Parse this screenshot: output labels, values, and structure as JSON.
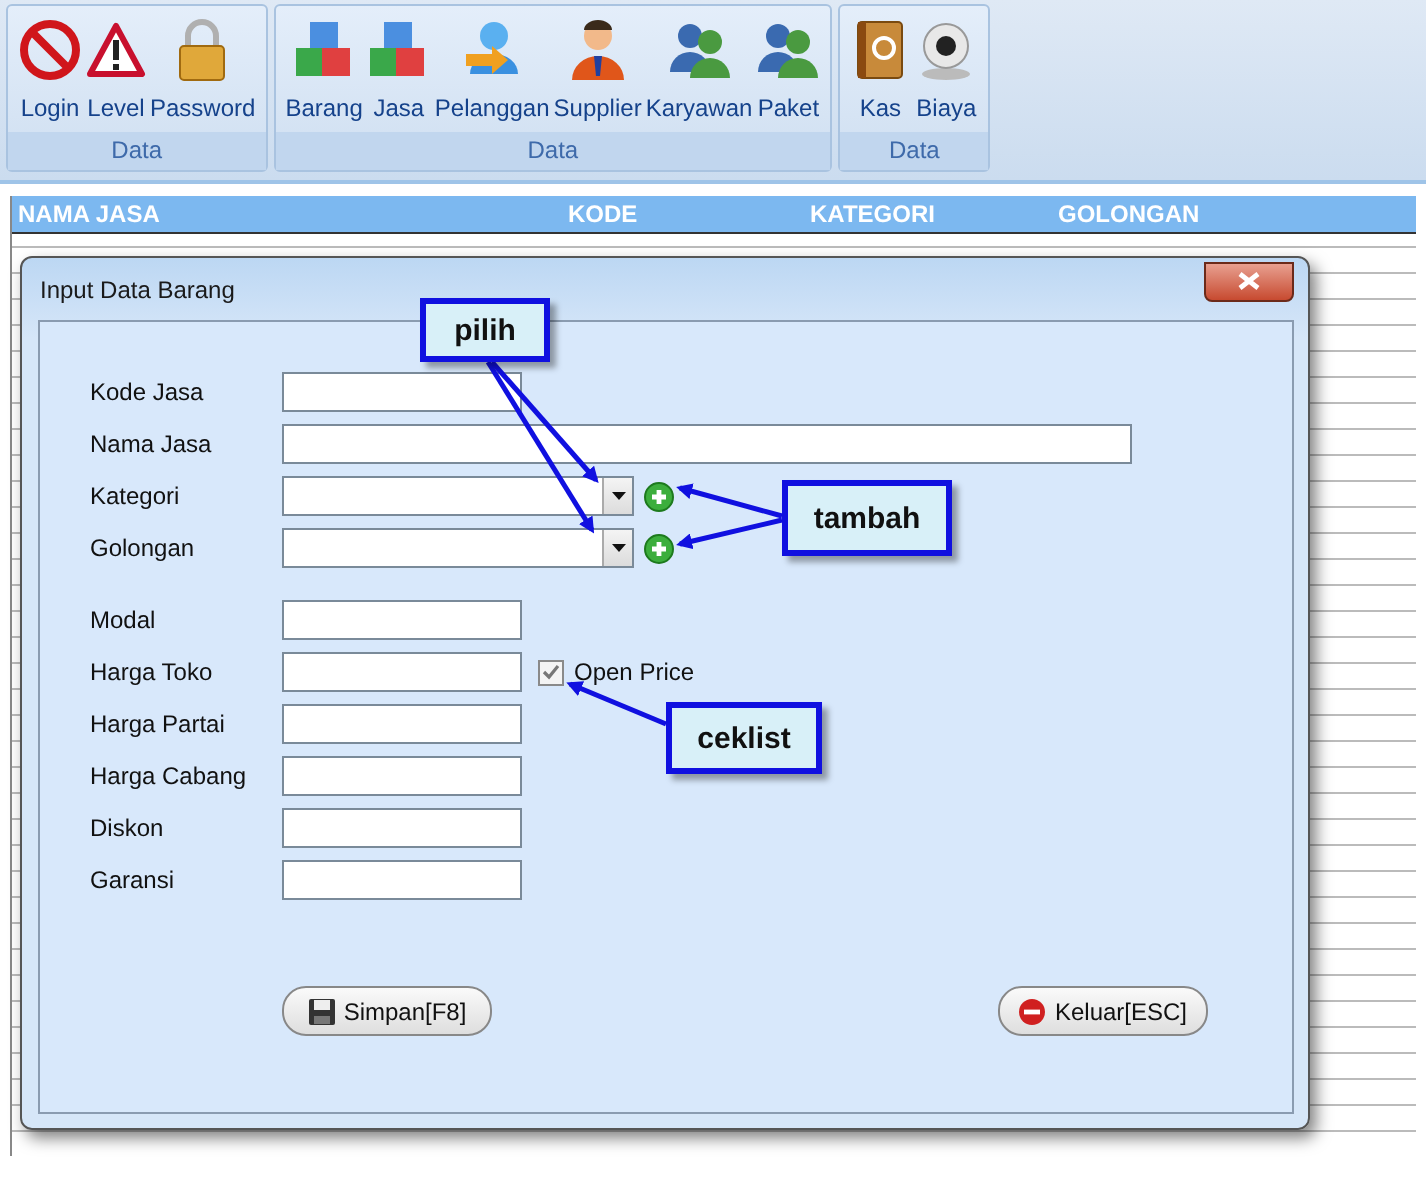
{
  "ribbon": {
    "groups": [
      {
        "caption": "Data",
        "items": [
          {
            "label": "Login",
            "kind": "forbid"
          },
          {
            "label": "Level",
            "kind": "warning"
          },
          {
            "label": "Password",
            "kind": "lock"
          }
        ]
      },
      {
        "caption": "Data",
        "items": [
          {
            "label": "Barang",
            "kind": "cubes"
          },
          {
            "label": "Jasa",
            "kind": "cubes"
          },
          {
            "label": "Pelanggan",
            "kind": "person-arrow"
          },
          {
            "label": "Supplier",
            "kind": "person"
          },
          {
            "label": "Karyawan",
            "kind": "people"
          },
          {
            "label": "Paket",
            "kind": "people"
          }
        ]
      },
      {
        "caption": "Data",
        "items": [
          {
            "label": "Kas",
            "kind": "book"
          },
          {
            "label": "Biaya",
            "kind": "webcam"
          }
        ]
      }
    ]
  },
  "table": {
    "columns": [
      "NAMA JASA",
      "KODE",
      "KATEGORI",
      "GOLONGAN"
    ]
  },
  "dialog": {
    "title": "Input Data Barang",
    "sections": [
      [
        {
          "label": "Kode Jasa",
          "kind": "text"
        },
        {
          "label": "Nama Jasa",
          "kind": "wide"
        },
        {
          "label": "Kategori",
          "kind": "combo"
        },
        {
          "label": "Golongan",
          "kind": "combo"
        }
      ],
      [
        {
          "label": "Modal",
          "kind": "text"
        },
        {
          "label": "Harga Toko",
          "kind": "text",
          "checkbox": {
            "label": "Open Price",
            "checked": true
          }
        },
        {
          "label": "Harga Partai",
          "kind": "text"
        },
        {
          "label": "Harga Cabang",
          "kind": "text"
        },
        {
          "label": "Diskon",
          "kind": "text"
        },
        {
          "label": "Garansi",
          "kind": "text"
        }
      ]
    ],
    "buttons": [
      {
        "label": "Simpan[F8]",
        "kind": "save"
      },
      {
        "label": "Keluar[ESC]",
        "kind": "exit"
      }
    ]
  },
  "callouts": [
    "pilih",
    "tambah",
    "ceklist"
  ]
}
